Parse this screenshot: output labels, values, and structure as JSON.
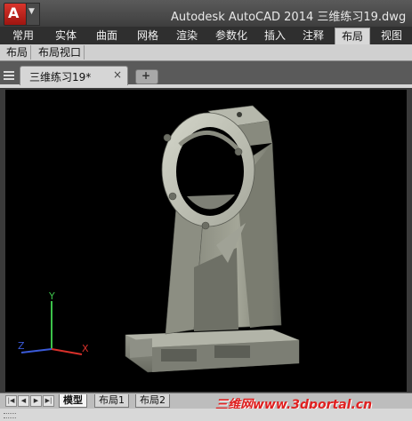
{
  "title_bar": {
    "app_icon": "A",
    "title": "Autodesk AutoCAD 2014    三维练习19.dwg"
  },
  "ribbon": {
    "tabs": [
      "常用",
      "实体",
      "曲面",
      "网格",
      "渲染",
      "参数化",
      "插入",
      "注释",
      "布局",
      "视图"
    ],
    "active_tab": "布局",
    "panels": [
      "布局",
      "布局视口"
    ]
  },
  "file_tabs": {
    "active_file": "三维练习19*",
    "close_glyph": "×",
    "new_tab_glyph": "+"
  },
  "viewport": {
    "background": "#000000",
    "ucs": {
      "x_label": "X",
      "y_label": "Y",
      "z_label": "Z"
    }
  },
  "layout_tabs": {
    "tabs": [
      "模型",
      "布局1",
      "布局2"
    ],
    "active": "模型"
  },
  "watermark": "三维网www.3dportal.cn"
}
